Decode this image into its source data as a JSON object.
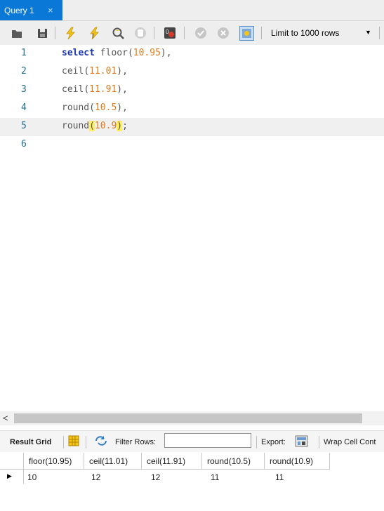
{
  "tab": {
    "title": "Query 1",
    "close": "×"
  },
  "toolbar": {
    "limit_label": "Limit to 1000 rows",
    "icons": [
      "open-file-icon",
      "save-icon",
      "execute-icon",
      "execute-current-icon",
      "explain-icon",
      "stop-icon",
      "toggle-error-icon",
      "commit-icon",
      "rollback-icon",
      "autocommit-icon"
    ]
  },
  "editor": {
    "line_numbers": [
      "1",
      "2",
      "3",
      "4",
      "5",
      "6"
    ],
    "lines": [
      {
        "kw": "select",
        "fn": "floor",
        "open": "(",
        "num": "10.95",
        "close": ")",
        "tail": ","
      },
      {
        "fn": "ceil",
        "open": "(",
        "num": "11.01",
        "close": ")",
        "tail": ","
      },
      {
        "fn": "ceil",
        "open": "(",
        "num": "11.91",
        "close": ")",
        "tail": ","
      },
      {
        "fn": "round",
        "open": "(",
        "num": "10.5",
        "close": ")",
        "tail": ","
      },
      {
        "fn": "round",
        "open": "(",
        "num": "10.9",
        "close": ")",
        "tail": ";"
      }
    ],
    "current_line": 5
  },
  "results_toolbar": {
    "result_grid": "Result Grid",
    "filter_rows": "Filter Rows:",
    "filter_value": "",
    "export": "Export:",
    "wrap": "Wrap Cell Cont"
  },
  "grid": {
    "columns": [
      "floor(10.95)",
      "ceil(11.01)",
      "ceil(11.91)",
      "round(10.5)",
      "round(10.9)"
    ],
    "row": [
      "10",
      "12",
      "12",
      "11",
      "11"
    ]
  },
  "colors": {
    "tab_accent": "#0a78d7",
    "keyword": "#1a36b4",
    "number": "#de7a1b",
    "line_number": "#1f6f93",
    "brace_highlight": "#ffee60"
  }
}
